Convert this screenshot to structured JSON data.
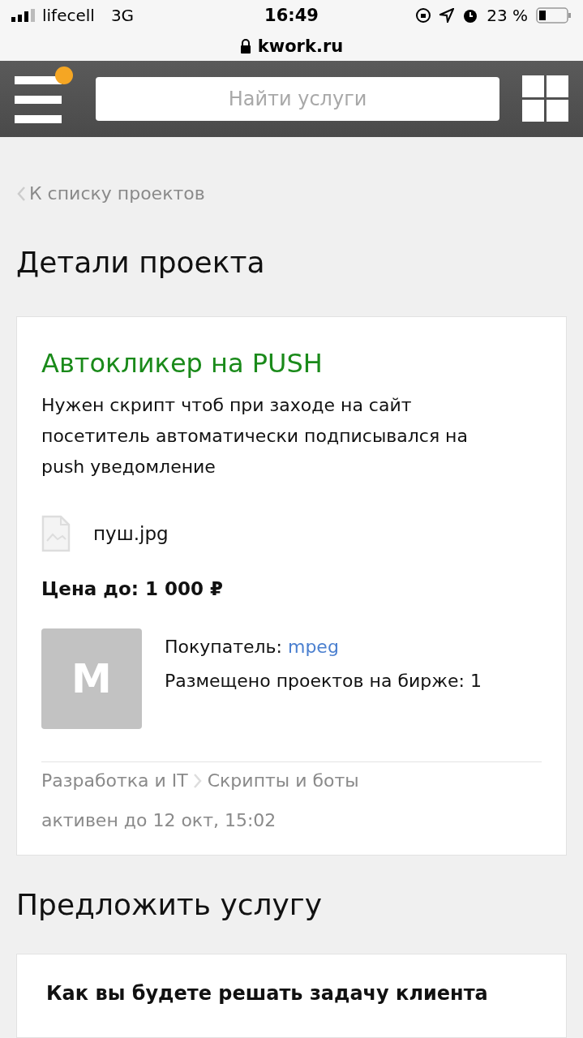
{
  "status_bar": {
    "carrier": "lifecell",
    "network": "3G",
    "time": "16:49",
    "battery": "23 %"
  },
  "address_bar": {
    "domain": "kwork.ru"
  },
  "header": {
    "search": {
      "placeholder": "Найти услуги"
    },
    "menu_badge": true
  },
  "back_link": "К списку проектов",
  "details_heading": "Детали проекта",
  "project": {
    "title": "Автокликер на PUSH",
    "description": "Нужен скрипт чтоб при заходе на сайт посетитель автоматически подписывался на push уведомление",
    "attachment": "пуш.jpg",
    "price": "Цена до: 1 000 ₽",
    "buyer": {
      "avatar_letter": "M",
      "label": "Покупатель:",
      "name": "mpeg",
      "stats": "Размещено проектов на бирже: 1"
    },
    "breadcrumbs": [
      "Разработка и IT",
      "Скрипты и боты"
    ],
    "active_until": "активен до 12 окт, 15:02"
  },
  "offer_heading": "Предложить услугу",
  "offer_card": {
    "question": "Как вы будете решать задачу клиента"
  }
}
